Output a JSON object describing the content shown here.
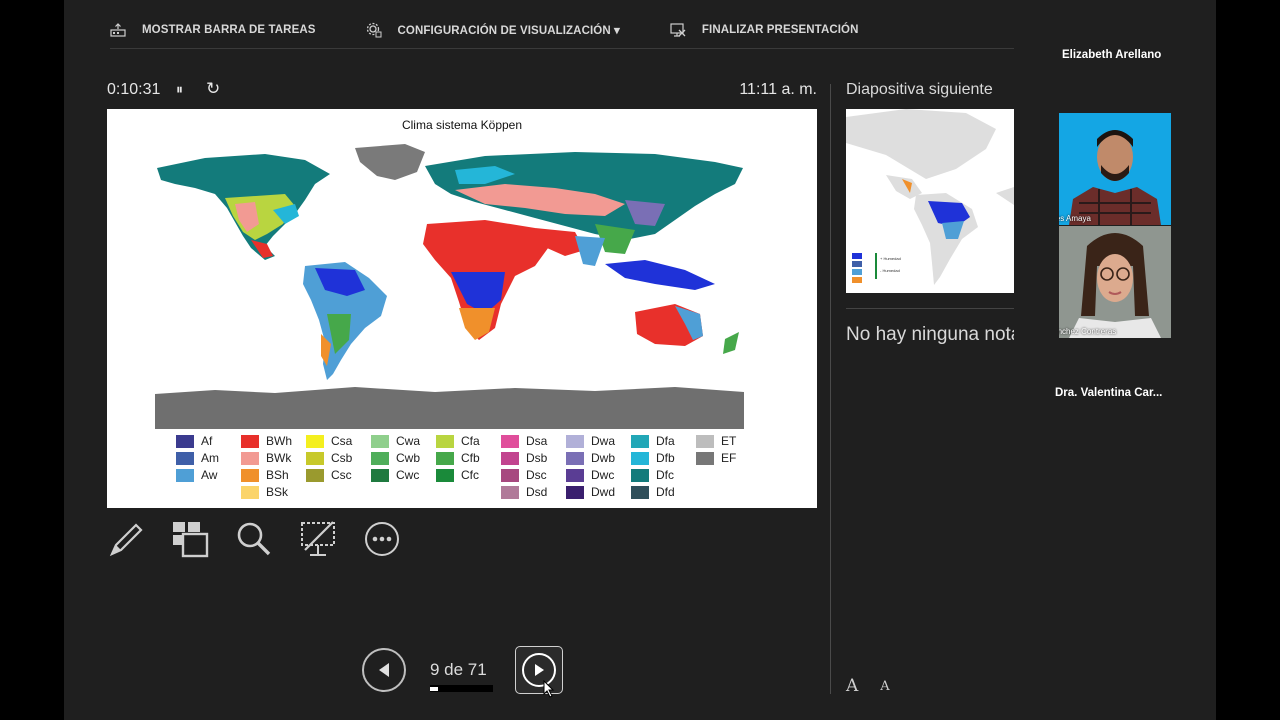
{
  "toolbar": {
    "show_taskbar": "MOSTRAR BARRA DE TAREAS",
    "display_settings": "CONFIGURACIÓN DE VISUALIZACIÓN ▾",
    "end_presentation": "FINALIZAR PRESENTACIÓN"
  },
  "timer": {
    "elapsed": "0:10:31",
    "pause_icon": "⏸",
    "reset_icon": "↻",
    "clock": "11:11 a. m."
  },
  "slide": {
    "title": "Clima sistema Köppen",
    "legend": [
      {
        "code": "Af",
        "color": "#3b3b8f"
      },
      {
        "code": "Am",
        "color": "#3f5fa8"
      },
      {
        "code": "Aw",
        "color": "#4f9fd6"
      },
      {
        "code": "BWh",
        "color": "#e8302b"
      },
      {
        "code": "BWk",
        "color": "#f29a93"
      },
      {
        "code": "BSh",
        "color": "#f0902b"
      },
      {
        "code": "BSk",
        "color": "#fbd46a"
      },
      {
        "code": "Csa",
        "color": "#f4ef1f"
      },
      {
        "code": "Csb",
        "color": "#c7c92a"
      },
      {
        "code": "Csc",
        "color": "#9a9a2e"
      },
      {
        "code": "Cwa",
        "color": "#8fcf8c"
      },
      {
        "code": "Cwb",
        "color": "#4fae5a"
      },
      {
        "code": "Cwc",
        "color": "#1f7a3f"
      },
      {
        "code": "Cfa",
        "color": "#b9d540"
      },
      {
        "code": "Cfb",
        "color": "#46a84a"
      },
      {
        "code": "Cfc",
        "color": "#1a8a3a"
      },
      {
        "code": "Dsa",
        "color": "#e04e9b"
      },
      {
        "code": "Dsb",
        "color": "#c2448f"
      },
      {
        "code": "Dsc",
        "color": "#a7487f"
      },
      {
        "code": "Dsd",
        "color": "#b07a99"
      },
      {
        "code": "Dwa",
        "color": "#b1b0d8"
      },
      {
        "code": "Dwb",
        "color": "#7a6fb5"
      },
      {
        "code": "Dwc",
        "color": "#5a3d94"
      },
      {
        "code": "Dwd",
        "color": "#3a1f6e"
      },
      {
        "code": "Dfa",
        "color": "#22a7b7"
      },
      {
        "code": "Dfb",
        "color": "#24b6d8"
      },
      {
        "code": "Dfc",
        "color": "#137b7b"
      },
      {
        "code": "Dfd",
        "color": "#2f4f5a"
      },
      {
        "code": "ET",
        "color": "#bdbdbd"
      },
      {
        "code": "EF",
        "color": "#777777"
      }
    ]
  },
  "navigation": {
    "counter": "9 de 71",
    "current": 9,
    "total": 71
  },
  "right_panel": {
    "next_slide_label": "Diapositiva siguiente",
    "next_thumb_legend": [
      "+ Humedad",
      "- Humedad"
    ],
    "notes": "No hay ninguna nota."
  },
  "participants": {
    "top_name": "Elizabeth Arellano",
    "video1_name": "Josue Reyes Amaya",
    "video2_name": "Adriana Sánchez Contreras",
    "bottom_name": "Dra. Valentina Car..."
  },
  "font_buttons": {
    "increase": "A",
    "decrease": "A"
  }
}
